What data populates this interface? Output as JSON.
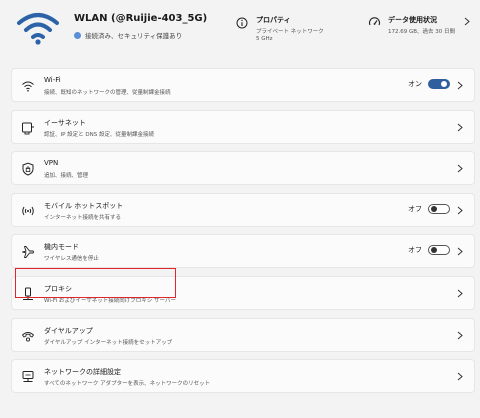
{
  "header": {
    "network_name": "WLAN (@Ruijie-403_5G)",
    "status": "接続済み、セキュリティ保護あり",
    "properties": {
      "title": "プロパティ",
      "line1": "プライベート ネットワーク",
      "line2": "5 GHz"
    },
    "data_usage": {
      "title": "データ使用状況",
      "detail": "172.69 GB、過去 30 日間"
    }
  },
  "rows": [
    {
      "title": "Wi-Fi",
      "desc": "接続、既知のネットワークの管理、従量制課金接続",
      "toggle_label": "オン",
      "toggle_on": true
    },
    {
      "title": "イーサネット",
      "desc": "認証、IP 設定と DNS 設定、従量制課金接続"
    },
    {
      "title": "VPN",
      "desc": "追加、接続、管理"
    },
    {
      "title": "モバイル ホットスポット",
      "desc": "インターネット接続を共有する",
      "toggle_label": "オフ",
      "toggle_on": false
    },
    {
      "title": "機内モード",
      "desc": "ワイヤレス通信を停止",
      "toggle_label": "オフ",
      "toggle_on": false
    },
    {
      "title": "プロキシ",
      "desc": "Wi-Fi およびイーサネット接続向けプロキシ サーバー"
    },
    {
      "title": "ダイヤルアップ",
      "desc": "ダイヤルアップ インターネット接続をセットアップ"
    },
    {
      "title": "ネットワークの詳細設定",
      "desc": "すべてのネットワーク アダプターを表示、ネットワークのリセット"
    }
  ],
  "colors": {
    "accent": "#2f5f9f",
    "highlight": "#e0262a",
    "background": "#f3f3f3"
  }
}
